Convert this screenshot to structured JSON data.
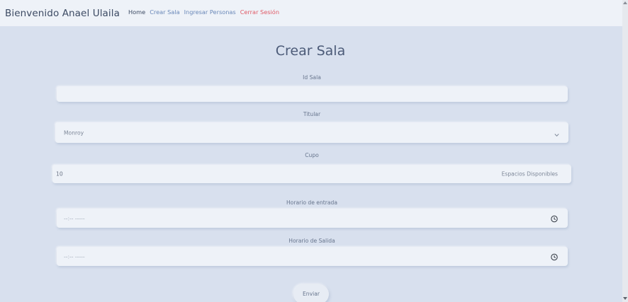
{
  "navbar": {
    "brand": "Bienvenido Anael Ulaila",
    "links": [
      {
        "label": "Home"
      },
      {
        "label": "Crear Sala"
      },
      {
        "label": "Ingresar Personas"
      },
      {
        "label": "Cerrar Sesión"
      }
    ]
  },
  "form": {
    "title": "Crear Sala",
    "id_sala": {
      "label": "Id Sala",
      "value": ""
    },
    "titular": {
      "label": "Titular",
      "selected": "Monroy",
      "icon": "chevron-down-icon"
    },
    "cupo": {
      "label": "Cupo",
      "value": "10",
      "suffix": "Espacios Disponibles"
    },
    "horario_entrada": {
      "label": "Horario de entrada",
      "placeholder": "--:-- -----",
      "icon": "clock-icon"
    },
    "horario_salida": {
      "label": "Horario de Salida",
      "placeholder": "--:-- -----",
      "icon": "clock-icon"
    },
    "submit_label": "Enviar"
  },
  "colors": {
    "background": "#d8e0ee",
    "navbar": "#eef2f8",
    "field": "#eef2f8",
    "link": "#6a88b8",
    "logout": "#e05a66"
  }
}
